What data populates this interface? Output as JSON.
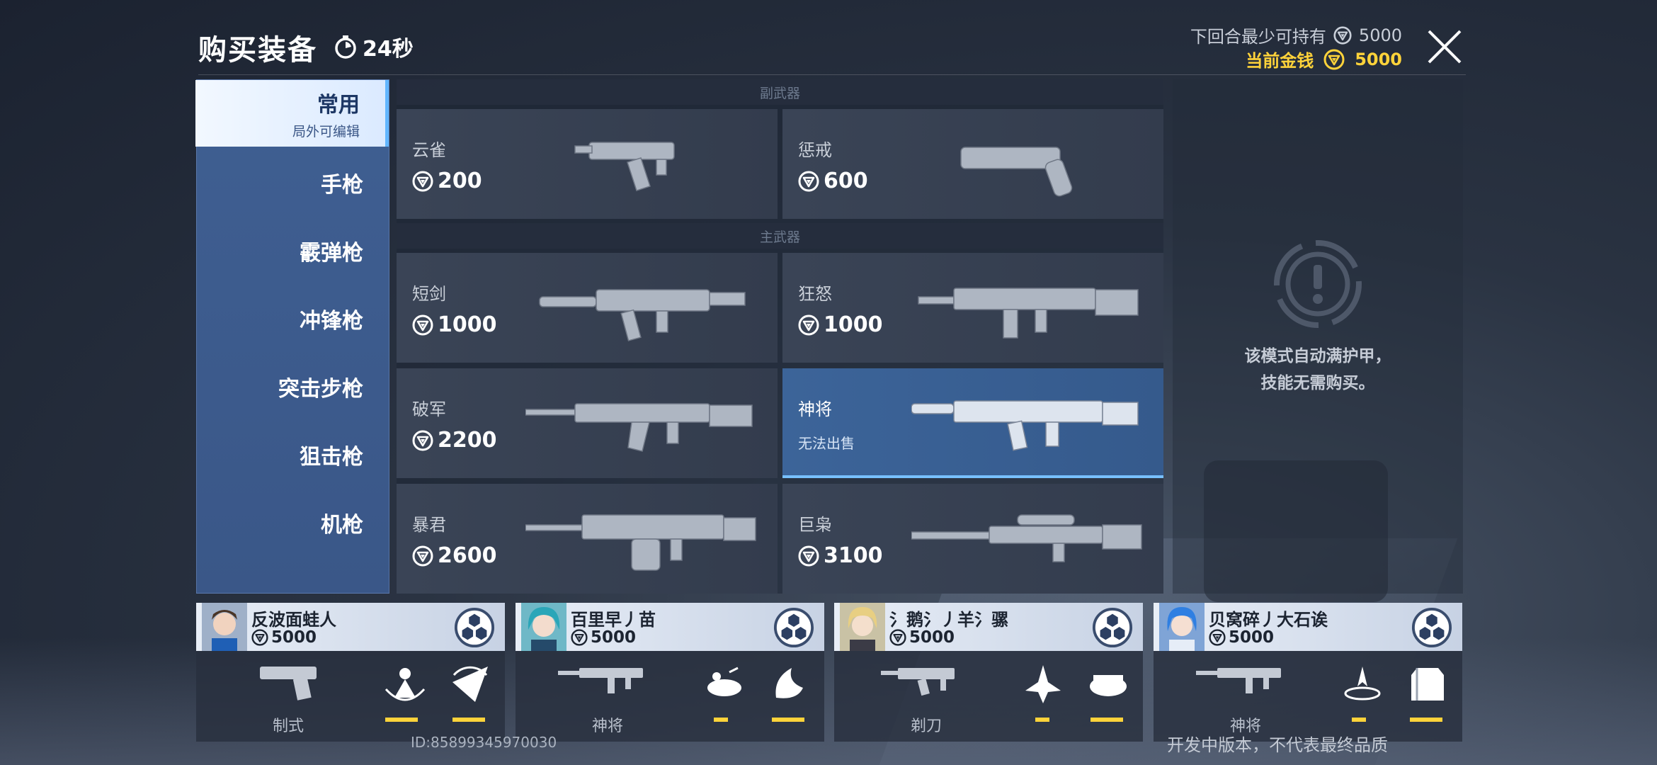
{
  "header": {
    "title": "购买装备",
    "timer": "24秒",
    "min_hold_label": "下回合最少可持有",
    "min_hold_value": "5000",
    "current_money_label": "当前金钱",
    "current_money_value": "5000"
  },
  "colors": {
    "accent_gold": "#ffd33a",
    "sidebar_blue": "#3f5f92",
    "active_tab": "#62b6ff"
  },
  "sidebar": {
    "items": [
      {
        "label": "常用",
        "sub": "局外可编辑"
      },
      {
        "label": "手枪"
      },
      {
        "label": "霰弹枪"
      },
      {
        "label": "冲锋枪"
      },
      {
        "label": "突击步枪"
      },
      {
        "label": "狙击枪"
      },
      {
        "label": "机枪"
      }
    ]
  },
  "sections": {
    "secondary": "副武器",
    "primary": "主武器"
  },
  "weapons": [
    {
      "name": "云雀",
      "price": "200"
    },
    {
      "name": "惩戒",
      "price": "600"
    },
    {
      "name": "短剑",
      "price": "1000"
    },
    {
      "name": "狂怒",
      "price": "1000"
    },
    {
      "name": "破军",
      "price": "2200"
    },
    {
      "name": "神将",
      "note": "无法出售"
    },
    {
      "name": "暴君",
      "price": "2600"
    },
    {
      "name": "巨枭",
      "price": "3100"
    }
  ],
  "info": {
    "line1": "该模式自动满护甲，",
    "line2": "技能无需购买。"
  },
  "players": [
    {
      "name": "反波面蛙人",
      "money": "5000",
      "weapon": "制式"
    },
    {
      "name": "百里早丿苗",
      "money": "5000",
      "weapon": "神将"
    },
    {
      "name": "氵鹅氵丿羊氵骡",
      "money": "5000",
      "weapon": "剃刀"
    },
    {
      "name": "贝窝碎丿大石诶",
      "money": "5000",
      "weapon": "神将"
    }
  ],
  "footer": {
    "uid": "ID:85899345970030",
    "disclaimer": "开发中版本，不代表最终品质"
  }
}
